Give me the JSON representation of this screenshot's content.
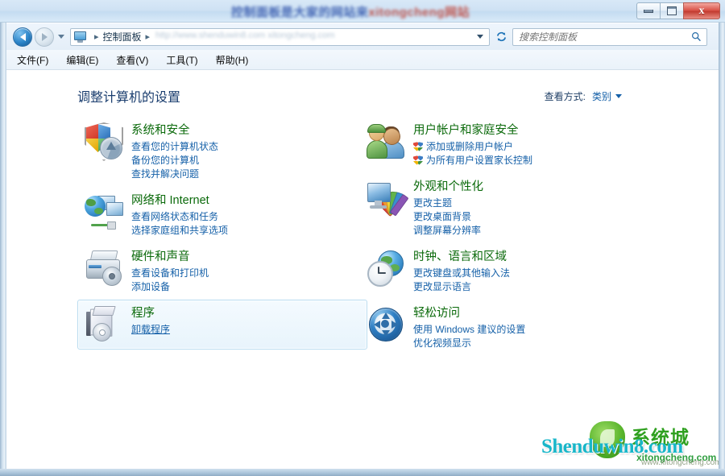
{
  "window": {
    "title_watermark_blue": "控制面板是大家的网站来",
    "title_watermark_red": "xitongcheng网站",
    "minimize_label": "最小化",
    "maximize_label": "最大化",
    "close_label": "x"
  },
  "addressbar": {
    "back_label": "后退",
    "forward_label": "前进",
    "recent_label": "最近浏览的位置",
    "breadcrumb": [
      "控制面板"
    ],
    "separator": "▸",
    "refresh_label": "刷新",
    "watermark": "http://www.shenduwin8.com xitongcheng.com"
  },
  "search": {
    "placeholder": "搜索控制面板",
    "value": "",
    "icon": "search-icon"
  },
  "menubar": {
    "items": [
      {
        "label": "文件(F)"
      },
      {
        "label": "编辑(E)"
      },
      {
        "label": "查看(V)"
      },
      {
        "label": "工具(T)"
      },
      {
        "label": "帮助(H)"
      }
    ]
  },
  "page": {
    "heading": "调整计算机的设置",
    "view_by_label": "查看方式:",
    "view_by_value": "类别"
  },
  "categories_left": [
    {
      "icon": "security-shield-icon",
      "title": "系统和安全",
      "links": [
        {
          "label": "查看您的计算机状态",
          "shield": false,
          "underline": false
        },
        {
          "label": "备份您的计算机",
          "shield": false,
          "underline": false
        },
        {
          "label": "查找并解决问题",
          "shield": false,
          "underline": false
        }
      ],
      "hover": false
    },
    {
      "icon": "network-globe-icon",
      "title": "网络和 Internet",
      "links": [
        {
          "label": "查看网络状态和任务",
          "shield": false,
          "underline": false
        },
        {
          "label": "选择家庭组和共享选项",
          "shield": false,
          "underline": false
        }
      ],
      "hover": false
    },
    {
      "icon": "printer-hardware-icon",
      "title": "硬件和声音",
      "links": [
        {
          "label": "查看设备和打印机",
          "shield": false,
          "underline": false
        },
        {
          "label": "添加设备",
          "shield": false,
          "underline": false
        }
      ],
      "hover": false
    },
    {
      "icon": "programs-box-icon",
      "title": "程序",
      "links": [
        {
          "label": "卸载程序",
          "shield": false,
          "underline": true
        }
      ],
      "hover": true
    }
  ],
  "categories_right": [
    {
      "icon": "user-accounts-icon",
      "title": "用户帐户和家庭安全",
      "links": [
        {
          "label": "添加或删除用户帐户",
          "shield": true,
          "underline": false
        },
        {
          "label": "为所有用户设置家长控制",
          "shield": true,
          "underline": false
        }
      ],
      "hover": false
    },
    {
      "icon": "appearance-personalization-icon",
      "title": "外观和个性化",
      "links": [
        {
          "label": "更改主题",
          "shield": false,
          "underline": false
        },
        {
          "label": "更改桌面背景",
          "shield": false,
          "underline": false
        },
        {
          "label": "调整屏幕分辨率",
          "shield": false,
          "underline": false
        }
      ],
      "hover": false
    },
    {
      "icon": "clock-language-region-icon",
      "title": "时钟、语言和区域",
      "links": [
        {
          "label": "更改键盘或其他输入法",
          "shield": false,
          "underline": false
        },
        {
          "label": "更改显示语言",
          "shield": false,
          "underline": false
        }
      ],
      "hover": false
    },
    {
      "icon": "ease-of-access-icon",
      "title": "轻松访问",
      "links": [
        {
          "label": "使用 Windows 建议的设置",
          "shield": false,
          "underline": false
        },
        {
          "label": "优化视频显示",
          "shield": false,
          "underline": false
        }
      ],
      "hover": false
    }
  ],
  "watermarks": {
    "primary": "Shenduwin8.com",
    "secondary_cn": "系统城",
    "secondary_en": "xitongcheng.com",
    "secondary_en2": "www.xitongcheng.com"
  },
  "colors": {
    "category_title": "#0b6a0b",
    "link": "#1560a8",
    "heading": "#1b3e6f",
    "titlebar": "#cfe2f4",
    "close_button": "#c23b30",
    "watermark_primary": "#18b6c9",
    "watermark_secondary": "#2fa01f"
  }
}
